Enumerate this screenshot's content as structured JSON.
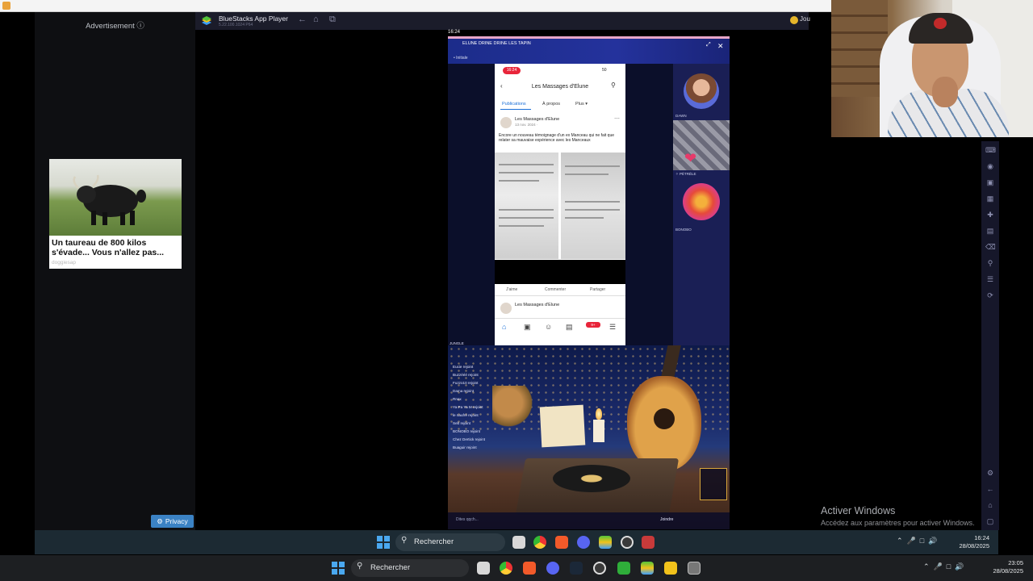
{
  "ad": {
    "label": "Advertisement ⓘ",
    "headline": "Un taureau de 800 kilos s'évade... Vous n'allez pas...",
    "source": "doggiesap",
    "privacy_label": "Privacy"
  },
  "bluestacks": {
    "title": "BlueStacks App Player",
    "subtitle": "5.22.100.1024 P64",
    "game_label": "Jou",
    "icons": [
      "back-icon",
      "home-icon",
      "multi-instance-icon"
    ]
  },
  "stream": {
    "clock": "16:24",
    "title": "ELUNE DRINE DRINE LES TAPIN",
    "sub": "• Initiale",
    "phone": {
      "rec_time": "16:24",
      "status": "50",
      "page_title": "Les Massages d'Elune",
      "tabs": [
        "Publications",
        "À propos",
        "Plus ▾"
      ],
      "post_author": "Les Massages d'Elune",
      "post_date": "13 nov. 2024 ·",
      "post_text": "Encore un nouveau témoignage d'un ex Manceau qui ne fait que relater sa mauvaise expérience avec les Manceaux",
      "actions": [
        "J'aime",
        "Commenter",
        "Partager"
      ],
      "post2_author": "Les Massages d'Elune",
      "nav_badge": "9+"
    },
    "side_labels": [
      "DAWN",
      "✧ PÉTRÉLE",
      "BONOBO"
    ],
    "jungle_label": "JUNGLE",
    "chat": [
      "Eucie rejoint",
      "Buzzééé rejoint",
      "Fuzzo10 rejoint",
      "Dama rejoint",
      "Rnax",
      "Ya Pa Ya M rejoint",
      "le naufré rejoint",
      "Seb rejoint",
      "BONOBO rejoint",
      "Chez Dertick rejoint",
      "Buaguir rejoint"
    ],
    "input_placeholder": "Dites qqch...",
    "join_label": "Joindre"
  },
  "watermark": {
    "title": "Activer Windows",
    "subtitle": "Accédez aux paramètres pour activer Windows."
  },
  "inner_taskbar": {
    "search_text": "Rechercher",
    "time": "16:24",
    "date": "28/08/2025"
  },
  "outer_taskbar": {
    "search_text": "Rechercher",
    "time": "23:05",
    "date": "28/08/2025"
  },
  "colors": {
    "bluestacks_bar": "#1b1c2a",
    "stream_header": "#24329c",
    "privacy_button": "#3b82c4",
    "taskbar_inner": "#1c2a33",
    "taskbar_outer": "#1d1f22"
  }
}
